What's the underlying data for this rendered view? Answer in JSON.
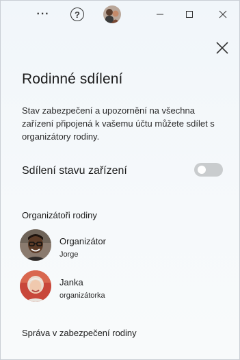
{
  "titlebar": {
    "more_label": "···",
    "help_label": "?"
  },
  "panel": {
    "title": "Rodinné sdílení",
    "description": "Stav zabezpečení a upozornění na všechna zařízení připojená k vašemu účtu můžete sdílet s organizátory rodiny.",
    "toggle_label": "Sdílení stavu zařízení",
    "toggle_on": false,
    "organizers_heading": "Organizátoři rodiny",
    "members": [
      {
        "name": "Organizátor",
        "role": "Jorge"
      },
      {
        "name": "Janka",
        "role": "organizátorka"
      }
    ],
    "footer_link": "Správa v zabezpečení rodiny"
  },
  "colors": {
    "background": "#f4f8fa",
    "toggle_off": "#c9ccce",
    "text": "#1b1b1b"
  }
}
